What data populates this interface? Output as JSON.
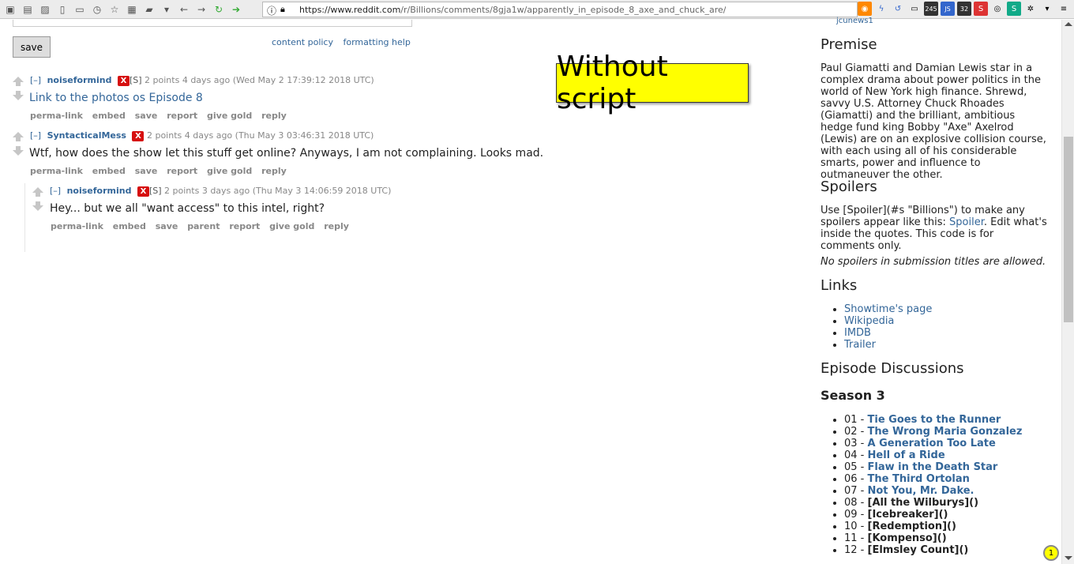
{
  "browser": {
    "url_host": "https://www.reddit.com",
    "url_path": "/r/Billions/comments/8gja1w/apparently_in_episode_8_axe_and_chuck_are/",
    "badge_245": "245",
    "badge_32": "32"
  },
  "form": {
    "save_label": "save",
    "content_policy": "content policy",
    "formatting_help": "formatting help"
  },
  "stamp_text": "Without script",
  "comments": [
    {
      "toggle": "[–]",
      "author": "noiseformind",
      "badge": "X",
      "op": "[S]",
      "meta": "2 points 4 days ago (Wed May 2 17:39:12 2018 UTC)",
      "body": "Link to the photos os Episode 8",
      "buttons": [
        "perma-link",
        "embed",
        "save",
        "report",
        "give gold",
        "reply"
      ]
    },
    {
      "toggle": "[–]",
      "author": "SyntacticalMess",
      "badge": "X",
      "op": "",
      "meta": "2 points 4 days ago (Thu May 3 03:46:31 2018 UTC)",
      "body": "Wtf, how does the show let this stuff get online? Anyways, I am not complaining. Looks mad.",
      "buttons": [
        "perma-link",
        "embed",
        "save",
        "report",
        "give gold",
        "reply"
      ]
    },
    {
      "toggle": "[–]",
      "author": "noiseformind",
      "badge": "X",
      "op": "[S]",
      "meta": "2 points 3 days ago (Thu May 3 14:06:59 2018 UTC)",
      "body": "Hey... but we all \"want access\" to this intel, right?",
      "buttons": [
        "perma-link",
        "embed",
        "save",
        "parent",
        "report",
        "give gold",
        "reply"
      ]
    }
  ],
  "sidebar": {
    "top_clip": "jcunews1",
    "premise_title": "Premise",
    "premise_text": "Paul Giamatti and Damian Lewis star in a complex drama about power politics in the world of New York high finance. Shrewd, savvy U.S. Attorney Chuck Rhoades (Giamatti) and the brilliant, ambitious hedge fund king Bobby \"Axe\" Axelrod (Lewis) are on an explosive collision course, with each using all of his considerable smarts, power and influence to outmaneuver the other.",
    "spoilers_title": "Spoilers",
    "spoilers_pre": "Use [Spoiler](#s \"Billions\") to make any spoilers appear like this: ",
    "spoilers_link": "Spoiler",
    "spoilers_post": ". Edit what's inside the quotes. This code is for comments only.",
    "spoilers_note": "No spoilers in submission titles are allowed.",
    "links_title": "Links",
    "links": [
      "Showtime's page",
      "Wikipedia",
      "IMDB",
      "Trailer"
    ],
    "episodes_title": "Episode Discussions",
    "season_title": "Season 3",
    "episodes": [
      {
        "num": "01 - ",
        "title": "Tie Goes to the Runner"
      },
      {
        "num": "02 - ",
        "title": "The Wrong Maria Gonzalez"
      },
      {
        "num": "03 - ",
        "title": "A Generation Too Late"
      },
      {
        "num": "04 - ",
        "title": "Hell of a Ride"
      },
      {
        "num": "05 - ",
        "title": "Flaw in the Death Star"
      },
      {
        "num": "06 - ",
        "title": "The Third Ortolan"
      },
      {
        "num": "07 - ",
        "title": "Not You, Mr. Dake."
      },
      {
        "num": "08 - ",
        "title": "[All the Wilburys]()"
      },
      {
        "num": "09 - ",
        "title": "[Icebreaker]()"
      },
      {
        "num": "10 - ",
        "title": "[Redemption]()"
      },
      {
        "num": "11 - ",
        "title": "[Kompenso]()"
      },
      {
        "num": "12 - ",
        "title": "[Elmsley Count]()"
      }
    ]
  },
  "corner_badge": "1"
}
